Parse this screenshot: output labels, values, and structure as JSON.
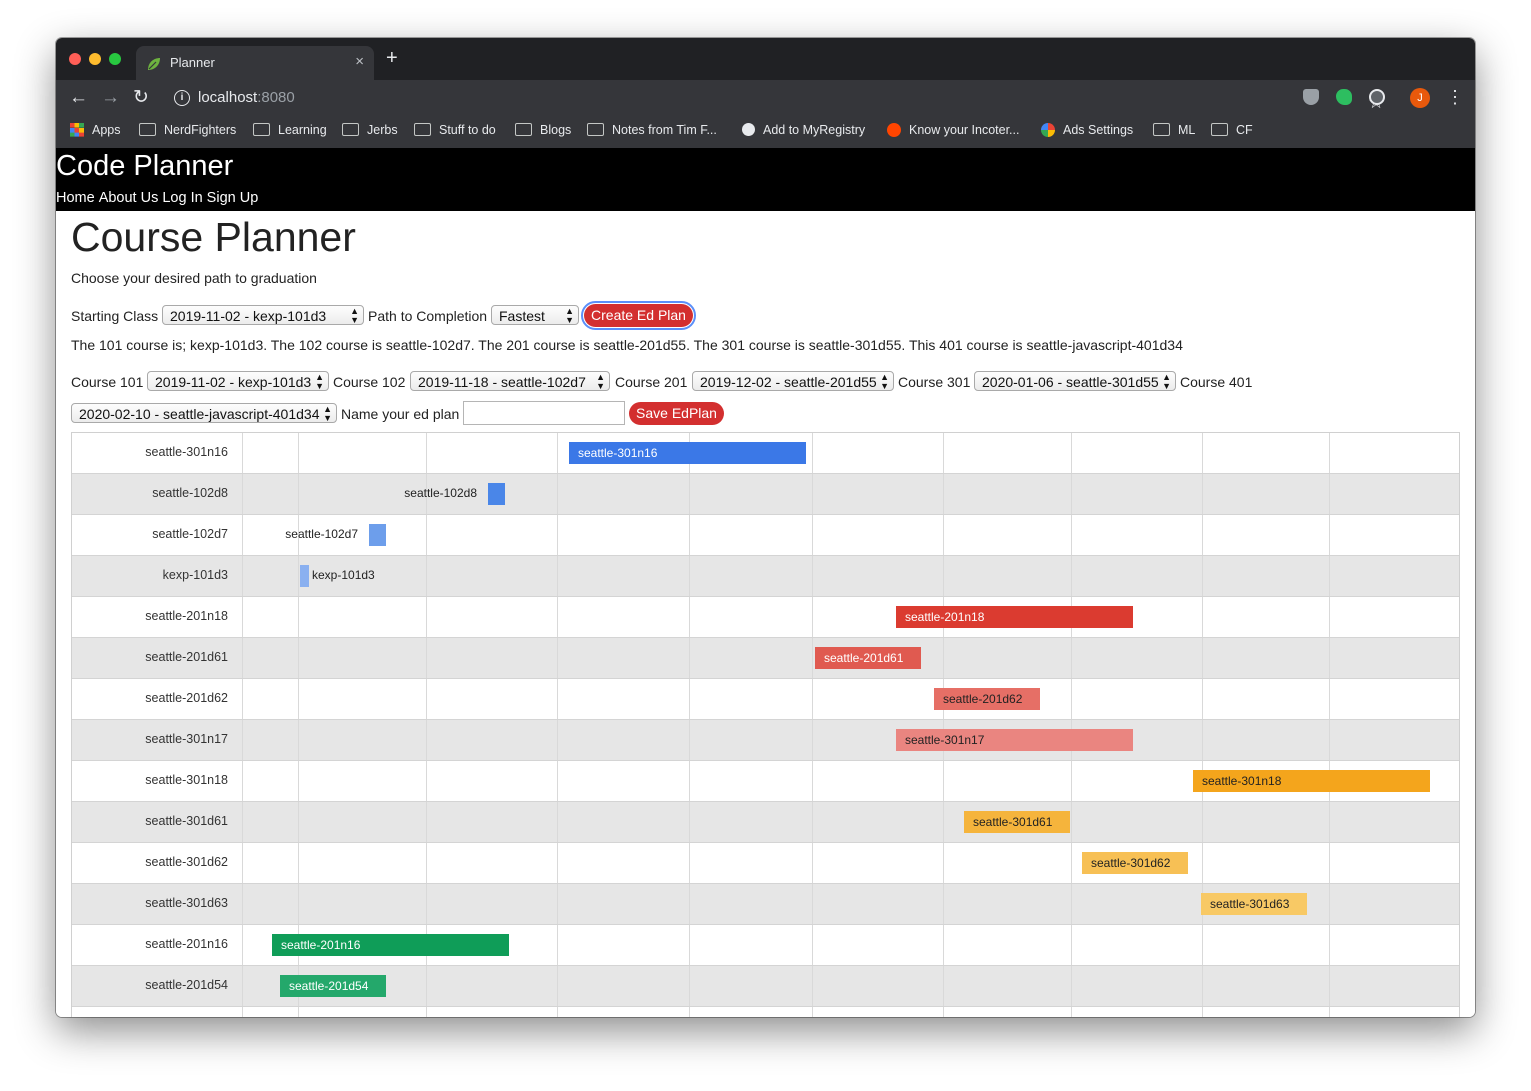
{
  "browser": {
    "tab_title": "Planner",
    "tab_close": "×",
    "new_tab": "+",
    "url_host": "localhost",
    "url_port": ":8080",
    "avatar_letter": "J",
    "bookmarks": [
      {
        "label": "Apps",
        "icon": "apps-grid-icon"
      },
      {
        "label": "NerdFighters",
        "icon": "folder-icon"
      },
      {
        "label": "Learning",
        "icon": "folder-icon"
      },
      {
        "label": "Jerbs",
        "icon": "folder-icon"
      },
      {
        "label": "Stuff to do",
        "icon": "folder-icon"
      },
      {
        "label": "Blogs",
        "icon": "folder-icon"
      },
      {
        "label": "Notes from Tim F...",
        "icon": "folder-icon"
      },
      {
        "label": "Add to MyRegistry",
        "icon": "globe-icon"
      },
      {
        "label": "Know your Incoter...",
        "icon": "reddit-icon"
      },
      {
        "label": "Ads Settings",
        "icon": "google-icon"
      },
      {
        "label": "ML",
        "icon": "folder-icon"
      },
      {
        "label": "CF",
        "icon": "folder-icon"
      }
    ]
  },
  "site": {
    "title": "Code Planner",
    "nav": [
      "Home",
      "About Us",
      "Log In",
      "Sign Up"
    ]
  },
  "planner": {
    "title": "Course Planner",
    "subtitle": "Choose your desired path to graduation",
    "starting_class_label": "Starting Class",
    "starting_class_value": "2019-11-02 - kexp-101d3",
    "path_label": "Path to Completion",
    "path_value": "Fastest",
    "create_button": "Create Ed Plan",
    "summary": "The 101 course is; kexp-101d3. The 102 course is seattle-102d7. The 201 course is seattle-201d55. The 301 course is seattle-301d55. This 401 course is seattle-javascript-401d34",
    "course101_label": "Course 101",
    "course101_value": "2019-11-02 - kexp-101d3",
    "course102_label": "Course 102",
    "course102_value": "2019-11-18 - seattle-102d7",
    "course201_label": "Course 201",
    "course201_value": "2019-12-02 - seattle-201d55",
    "course301_label": "Course 301",
    "course301_value": "2020-01-06 - seattle-301d55",
    "course401_label": "Course 401",
    "course401_value": "2020-02-10 - seattle-javascript-401d34",
    "name_label": "Name your ed plan",
    "name_value": "",
    "save_button": "Save EdPlan"
  },
  "timeline": {
    "rows": [
      {
        "label": "seattle-301n16",
        "bar": "seattle-301n16",
        "color": "#3b78e7",
        "text_color": "#ffffff"
      },
      {
        "label": "seattle-102d8",
        "bar": "seattle-102d8",
        "color": "#4a86e8",
        "text_color": "#222222"
      },
      {
        "label": "seattle-102d7",
        "bar": "seattle-102d7",
        "color": "#6d9eeb",
        "text_color": "#222222"
      },
      {
        "label": "kexp-101d3",
        "bar": "kexp-101d3",
        "color": "#8ab0f0",
        "text_color": "#222222"
      },
      {
        "label": "seattle-201n18",
        "bar": "seattle-201n18",
        "color": "#db3b30",
        "text_color": "#ffffff"
      },
      {
        "label": "seattle-201d61",
        "bar": "seattle-201d61",
        "color": "#e05a50",
        "text_color": "#ffffff"
      },
      {
        "label": "seattle-201d62",
        "bar": "seattle-201d62",
        "color": "#e66f66",
        "text_color": "#222222"
      },
      {
        "label": "seattle-301n17",
        "bar": "seattle-301n17",
        "color": "#ea8580",
        "text_color": "#222222"
      },
      {
        "label": "seattle-301n18",
        "bar": "seattle-301n18",
        "color": "#f4a51c",
        "text_color": "#222222"
      },
      {
        "label": "seattle-301d61",
        "bar": "seattle-301d61",
        "color": "#f5b43c",
        "text_color": "#222222"
      },
      {
        "label": "seattle-301d62",
        "bar": "seattle-301d62",
        "color": "#f7c055",
        "text_color": "#222222"
      },
      {
        "label": "seattle-301d63",
        "bar": "seattle-301d63",
        "color": "#f8c965",
        "text_color": "#222222"
      },
      {
        "label": "seattle-201n16",
        "bar": "seattle-201n16",
        "color": "#0f9d58",
        "text_color": "#ffffff"
      },
      {
        "label": "seattle-201d54",
        "bar": "seattle-201d54",
        "color": "#24a86b",
        "text_color": "#ffffff"
      },
      {
        "label": "",
        "bar": "",
        "color": "#2fb07a",
        "text_color": "#ffffff"
      }
    ]
  }
}
